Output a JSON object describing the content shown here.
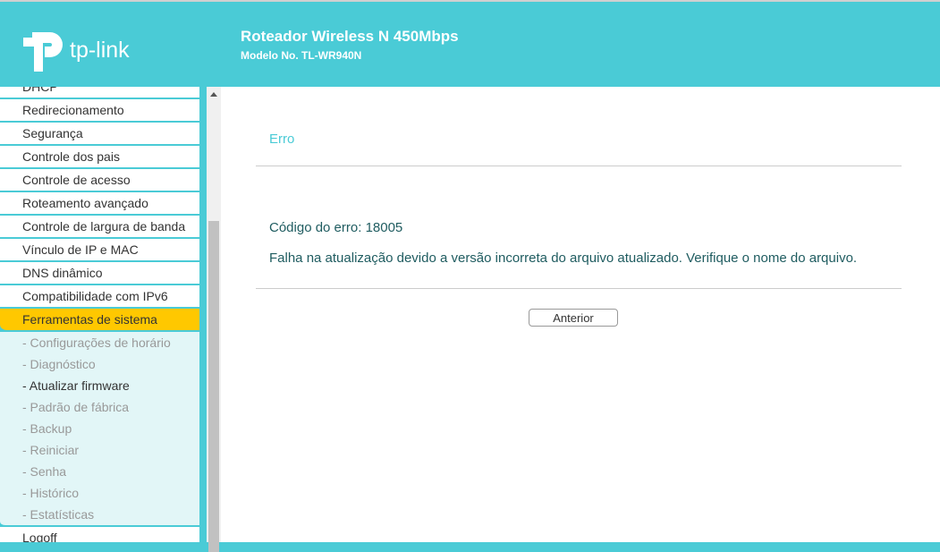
{
  "header": {
    "logo": "tp-link",
    "title": "Roteador Wireless N 450Mbps",
    "model": "Modelo No. TL-WR940N"
  },
  "sidebar": {
    "items": [
      {
        "label": "DHCP"
      },
      {
        "label": "Redirecionamento"
      },
      {
        "label": "Segurança"
      },
      {
        "label": "Controle dos pais"
      },
      {
        "label": "Controle de acesso"
      },
      {
        "label": "Roteamento avançado"
      },
      {
        "label": "Controle de largura de banda"
      },
      {
        "label": "Vínculo de IP e MAC"
      },
      {
        "label": "DNS dinâmico"
      },
      {
        "label": "Compatibilidade com IPv6"
      },
      {
        "label": "Ferramentas de sistema"
      }
    ],
    "subitems": [
      {
        "label": "- Configurações de horário"
      },
      {
        "label": "- Diagnóstico"
      },
      {
        "label": "- Atualizar firmware"
      },
      {
        "label": "- Padrão de fábrica"
      },
      {
        "label": "- Backup"
      },
      {
        "label": "- Reiniciar"
      },
      {
        "label": "- Senha"
      },
      {
        "label": "- Histórico"
      },
      {
        "label": "- Estatísticas"
      }
    ],
    "logoff": "Logoff"
  },
  "main": {
    "title": "Erro",
    "code": "Código do erro: 18005",
    "message": "Falha na atualização devido a versão incorreta do arquivo atualizado. Verifique o nome do arquivo.",
    "back_button": "Anterior"
  }
}
